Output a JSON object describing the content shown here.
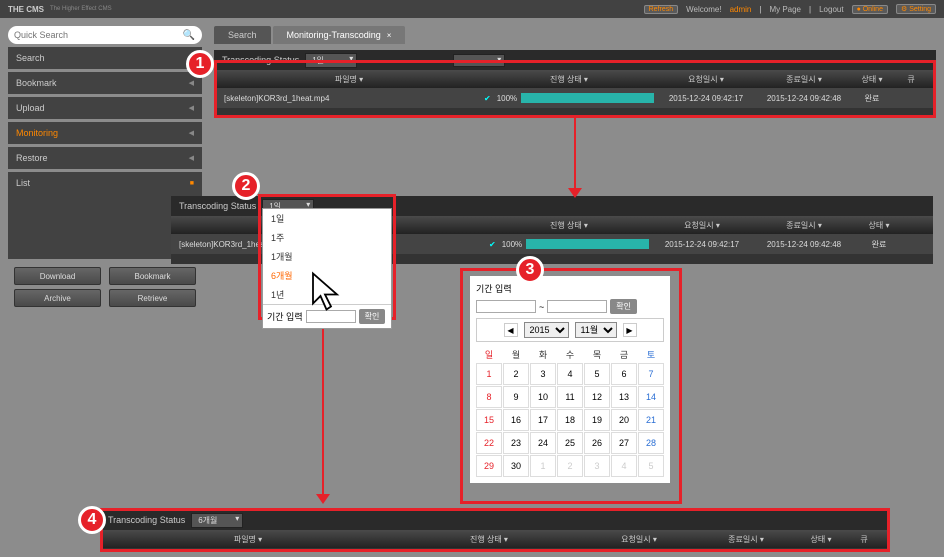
{
  "header": {
    "title": "THE CMS",
    "subtitle": "The Higher Effect CMS",
    "refresh": "Refresh",
    "welcome": "Welcome!",
    "admin": "admin",
    "mypage": "My Page",
    "logout": "Logout",
    "online": "● Online",
    "setting": "⚙ Setting"
  },
  "sidebar": {
    "placeholder": "Quick Search",
    "items": [
      "Search",
      "Bookmark",
      "Upload",
      "Monitoring",
      "Restore",
      "List"
    ],
    "buttons": [
      "Download",
      "Bookmark",
      "Archive",
      "Retrieve"
    ]
  },
  "tabs": {
    "inactive": "Search",
    "active": "Monitoring-Transcoding",
    "x": "×"
  },
  "panel1": {
    "title": "Transcoding  Status",
    "dd": "1일",
    "cols": {
      "file": "파일명 ▾",
      "prog": "진행 상태 ▾",
      "req": "요청일시 ▾",
      "end": "종료일시 ▾",
      "state": "상태 ▾",
      "queue": "큐"
    },
    "row": {
      "file": "[skeleton]KOR3rd_1heat.mp4",
      "pct": "100%",
      "req": "2015-12-24 09:42:17",
      "end": "2015-12-24 09:42:48",
      "state": "완료"
    }
  },
  "panel2": {
    "title": "Transcoding  Status",
    "dd": "1일",
    "cols": {
      "prog": "진행 상태 ▾",
      "req": "요청일시 ▾",
      "end": "종료일시 ▾",
      "state": "상태 ▾"
    },
    "row": {
      "file": "[skeleton]KOR3rd_1heat",
      "pct": "100%",
      "req": "2015-12-24 09:42:17",
      "end": "2015-12-24 09:42:48",
      "state": "완료"
    }
  },
  "dropdown": {
    "items": [
      "1일",
      "1주",
      "1개월",
      "6개월",
      "1년"
    ],
    "selected": "6개월",
    "custom_label": "기간 입력",
    "ok": "확인"
  },
  "calendar": {
    "label": "기간 입력",
    "tilde": "~",
    "ok": "확인",
    "prev": "◀",
    "next": "▶",
    "year": "2015",
    "month": "11월",
    "dow": [
      "일",
      "월",
      "화",
      "수",
      "목",
      "금",
      "토"
    ],
    "weeks": [
      [
        "1",
        "2",
        "3",
        "4",
        "5",
        "6",
        "7"
      ],
      [
        "8",
        "9",
        "10",
        "11",
        "12",
        "13",
        "14"
      ],
      [
        "15",
        "16",
        "17",
        "18",
        "19",
        "20",
        "21"
      ],
      [
        "22",
        "23",
        "24",
        "25",
        "26",
        "27",
        "28"
      ],
      [
        "29",
        "30",
        "1",
        "2",
        "3",
        "4",
        "5"
      ]
    ]
  },
  "panel4": {
    "title": "Transcoding  Status",
    "dd": "6개월",
    "cols": {
      "file": "파일명 ▾",
      "prog": "진행 상태 ▾",
      "req": "요청일시 ▾",
      "end": "종료일시 ▾",
      "state": "상태 ▾",
      "queue": "큐"
    }
  },
  "badges": [
    "1",
    "2",
    "3",
    "4"
  ]
}
